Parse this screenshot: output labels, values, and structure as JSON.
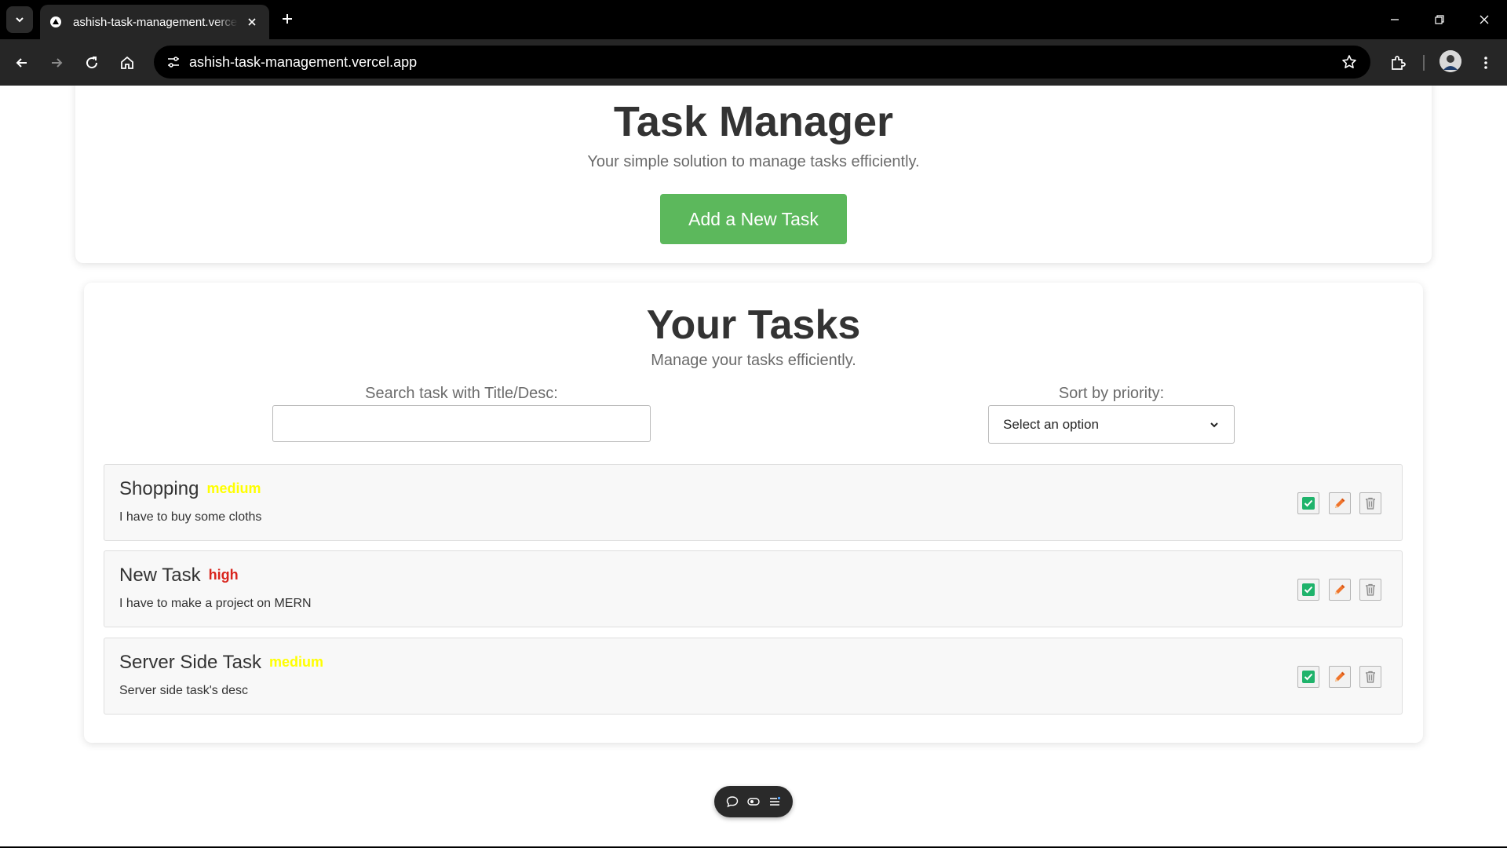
{
  "browser": {
    "tab_title": "ashish-task-management.vercel.app",
    "url": "ashish-task-management.vercel.app"
  },
  "header": {
    "title": "Task Manager",
    "subtitle": "Your simple solution to manage tasks efficiently.",
    "add_button_label": "Add a New Task"
  },
  "tasks_section": {
    "title": "Your Tasks",
    "subtitle": "Manage your tasks efficiently.",
    "search_label": "Search task with Title/Desc:",
    "search_value": "",
    "sort_label": "Sort by priority:",
    "sort_selected": "Select an option"
  },
  "tasks": [
    {
      "name": "Shopping",
      "priority": "medium",
      "desc": "I have to buy some cloths"
    },
    {
      "name": "New Task",
      "priority": "high",
      "desc": "I have to make a project on MERN"
    },
    {
      "name": "Server Side Task",
      "priority": "medium",
      "desc": "Server side task's desc"
    }
  ],
  "colors": {
    "add_button": "#5cb85c",
    "priority_medium": "#ffff00",
    "priority_high": "#d9241c",
    "complete_icon": "#1fb36b",
    "edit_icon": "#f0742b",
    "delete_icon": "#8a8a8a"
  },
  "icons": {
    "complete": "checkbox-checked-icon",
    "edit": "pencil-icon",
    "delete": "trash-icon"
  }
}
